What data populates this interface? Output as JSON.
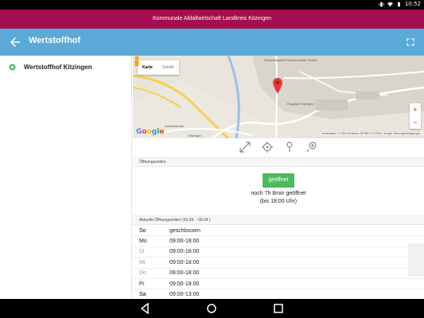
{
  "status_bar": {
    "time": "10:52",
    "icons": [
      "vibrate-icon",
      "wifi-icon",
      "battery-icon"
    ]
  },
  "brand_bar": {
    "title": "Kommunale Abfallwirtschaft Landkreis Kitzingen",
    "color": "#a50e4f"
  },
  "app_bar": {
    "title": "Wertstoffhof",
    "color": "#5aa9d6"
  },
  "sidebar": {
    "items": [
      {
        "label": "Wertstoffhof Kitzingen",
        "icon": "recycle-icon"
      }
    ]
  },
  "map": {
    "type_buttons": [
      "Karte",
      "Satellit"
    ],
    "labels": [
      "Gewerbegebiet Schwarzacher Straße",
      "Flugplatz Kitzingen",
      "Goethestraße",
      "Kitzingen"
    ],
    "attribution": "Kartendaten © 2016 GeoBasis-DE/BKG (©2009), Google   Nutzungsbedingungen",
    "logo": "Google",
    "zoom_in": "+",
    "zoom_out": "−"
  },
  "map_actions": [
    "fullscreen-icon",
    "locate-icon",
    "pin-icon",
    "add-pin-icon"
  ],
  "opening": {
    "section_title": "Öffnungszeiten",
    "status": "geöffnet",
    "remaining": "noch 7h 8min geöffnet",
    "until": "(bis 18:00 Uhr)",
    "status_color": "#4cbb5c"
  },
  "current_hours": {
    "section_title": "Aktuelle Öffnungszeiten (03.04. - 09.04.)",
    "rows": [
      {
        "day": "So",
        "time": "geschlossen"
      },
      {
        "day": "Mo",
        "time": "09:00-18:00"
      },
      {
        "day": "Di",
        "time": "09:00-18:00"
      },
      {
        "day": "Mi",
        "time": "09:00-18:00"
      },
      {
        "day": "Do",
        "time": "09:00-18:00"
      },
      {
        "day": "Fr",
        "time": "09:00-18:00"
      },
      {
        "day": "Sa",
        "time": "09:00-13:00"
      }
    ]
  }
}
